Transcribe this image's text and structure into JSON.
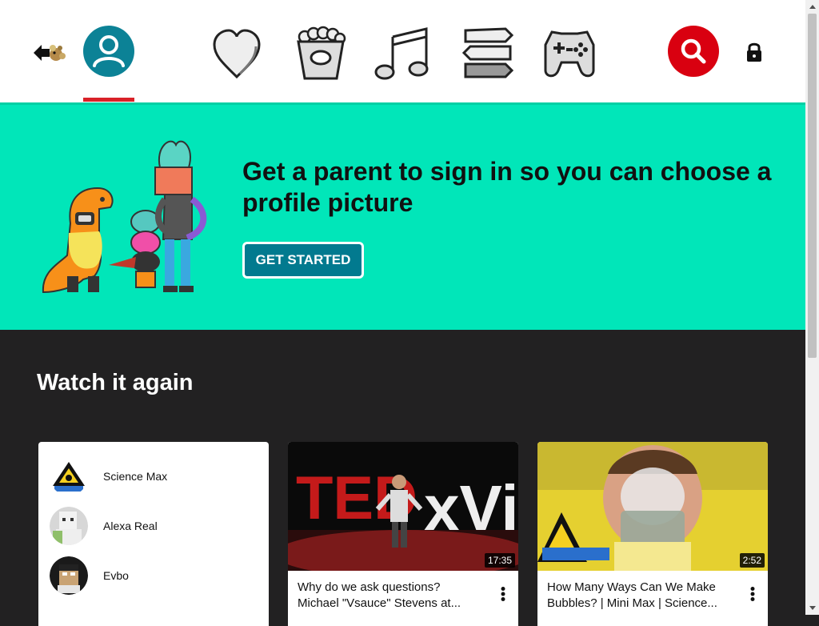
{
  "nav": {
    "items": [
      "back-logo",
      "profile",
      "shows",
      "videos",
      "music",
      "explore",
      "gaming"
    ],
    "active": "profile"
  },
  "banner": {
    "message": "Get a parent to sign in so you can choose a profile picture",
    "button_label": "GET STARTED",
    "background": "#01e6b9",
    "button_color": "#027a8f"
  },
  "watch_again": {
    "title": "Watch it again",
    "channels": [
      {
        "name": "Science Max"
      },
      {
        "name": "Alexa Real"
      },
      {
        "name": "Evbo"
      }
    ],
    "videos": [
      {
        "title_line1": "Why do we ask questions?",
        "title_line2": "Michael \"Vsauce\" Stevens at...",
        "duration": "17:35"
      },
      {
        "title_line1": "How Many Ways Can We Make",
        "title_line2": "Bubbles? | Mini Max | Science...",
        "duration": "2:52"
      }
    ]
  },
  "colors": {
    "accent_red": "#d92128",
    "search_red": "#d90010",
    "dark_bg": "#222122"
  }
}
